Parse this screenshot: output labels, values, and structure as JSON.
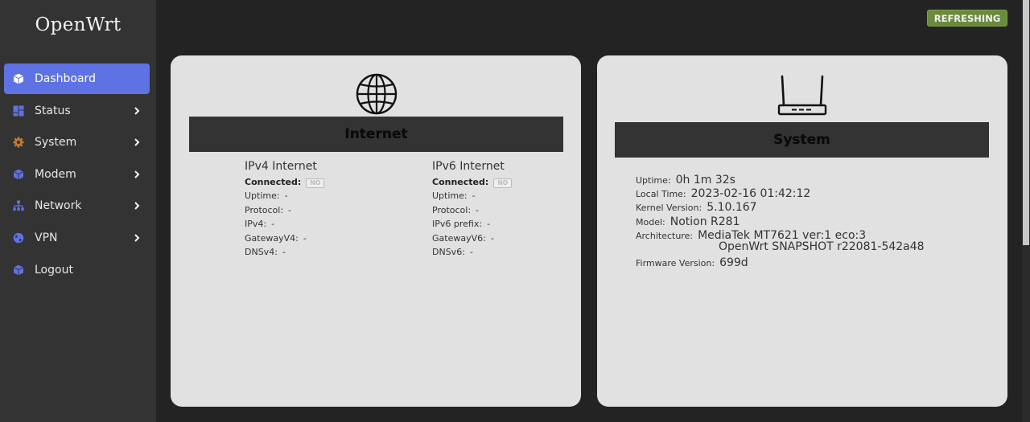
{
  "sidebar": {
    "brand": "OpenWrt",
    "items": [
      {
        "label": "Dashboard",
        "icon": "cube-icon",
        "active": true
      },
      {
        "label": "Status",
        "icon": "grid-icon",
        "chevron": true
      },
      {
        "label": "System",
        "icon": "gear-icon",
        "chevron": true
      },
      {
        "label": "Modem",
        "icon": "cube-icon",
        "chevron": true
      },
      {
        "label": "Network",
        "icon": "network-icon",
        "chevron": true
      },
      {
        "label": "VPN",
        "icon": "globe-icon",
        "chevron": true
      },
      {
        "label": "Logout",
        "icon": "cube-icon"
      }
    ]
  },
  "header": {
    "refresh_label": "REFRESHING",
    "refresh_color": "#6a8a3c"
  },
  "internet": {
    "title": "Internet",
    "icon": "globe-icon",
    "ipv4": {
      "title": "IPv4 Internet",
      "connected_label": "Connected:",
      "connected_value": "NO",
      "rows": [
        {
          "k": "Uptime:",
          "v": "-"
        },
        {
          "k": "Protocol:",
          "v": "-"
        },
        {
          "k": "IPv4:",
          "v": "-"
        },
        {
          "k": "GatewayV4:",
          "v": "-"
        },
        {
          "k": "DNSv4:",
          "v": "-"
        }
      ]
    },
    "ipv6": {
      "title": "IPv6 Internet",
      "connected_label": "Connected:",
      "connected_value": "NO",
      "rows": [
        {
          "k": "Uptime:",
          "v": "-"
        },
        {
          "k": "Protocol:",
          "v": "-"
        },
        {
          "k": "IPv6 prefix:",
          "v": "-"
        },
        {
          "k": "GatewayV6:",
          "v": "-"
        },
        {
          "k": "DNSv6:",
          "v": "-"
        }
      ]
    }
  },
  "system": {
    "title": "System",
    "icon": "router-icon",
    "uptime_label": "Uptime:",
    "uptime": "0h 1m 32s",
    "localtime_label": "Local Time:",
    "localtime": "2023-02-16 01:42:12",
    "kernel_label": "Kernel Version:",
    "kernel": "5.10.167",
    "model_label": "Model:",
    "model": "Notion R281",
    "arch_label": "Architecture:",
    "arch_line1": "MediaTek MT7621 ver:1 eco:3",
    "arch_line2": "OpenWrt SNAPSHOT r22081-542a48",
    "firmware_label": "Firmware Version:",
    "firmware": "699d"
  },
  "colors": {
    "sidebar_bg": "#333333",
    "page_bg": "#232323",
    "accent": "#5e72e4",
    "card_bg": "#e1e1e1"
  }
}
